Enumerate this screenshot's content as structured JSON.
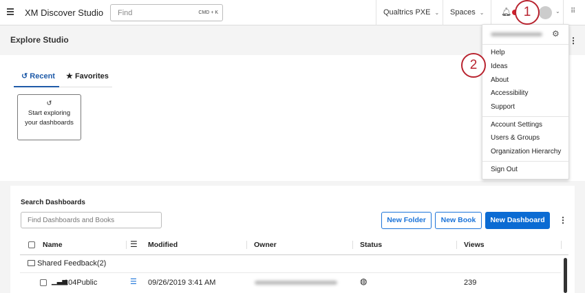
{
  "header": {
    "app_title": "XM Discover Studio",
    "find_placeholder": "Find",
    "find_shortcut": "CMD + K",
    "nav": [
      "Qualtrics PXE",
      "Spaces"
    ]
  },
  "page": {
    "title": "Explore Studio"
  },
  "tabs": [
    {
      "label": "Recent",
      "active": true
    },
    {
      "label": "Favorites",
      "active": false
    }
  ],
  "recent_card": {
    "line1": "Start exploring",
    "line2": "your dashboards"
  },
  "dashboards": {
    "section_title": "Search Dashboards",
    "search_placeholder": "Find Dashboards and Books",
    "buttons": {
      "new_folder": "New Folder",
      "new_book": "New Book",
      "new_dashboard": "New Dashboard"
    },
    "columns": [
      "Name",
      "Modified",
      "Owner",
      "Status",
      "Views"
    ],
    "folder": {
      "name": "Shared Feedback",
      "count": "(2)"
    },
    "rows": [
      {
        "name": "104Public",
        "modified": "09/26/2019 3:41 AM",
        "views": "239"
      }
    ]
  },
  "user_menu": {
    "items": [
      "Help",
      "Ideas",
      "About",
      "Accessibility",
      "Support"
    ],
    "admin_items": [
      "Account Settings",
      "Users & Groups",
      "Organization Hierarchy"
    ],
    "sign_out": "Sign Out"
  },
  "callouts": [
    "1",
    "2"
  ],
  "colors": {
    "accent": "#1a73d9",
    "callout": "#b8232f"
  }
}
